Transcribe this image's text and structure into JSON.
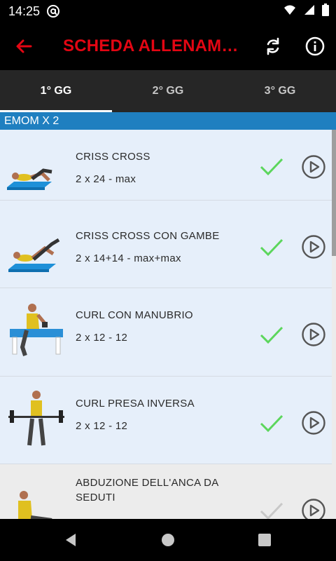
{
  "status": {
    "time": "14:25"
  },
  "header": {
    "title": "SCHEDA ALLENAME..."
  },
  "tabs": [
    {
      "label": "1° GG",
      "active": true
    },
    {
      "label": "2° GG",
      "active": false
    },
    {
      "label": "3° GG",
      "active": false
    }
  ],
  "section": {
    "label": "EMOM X 2"
  },
  "exercises": [
    {
      "title": "CRISS CROSS",
      "sets": "2 x 24 - max",
      "done": true
    },
    {
      "title": "CRISS CROSS CON GAMBE",
      "sets": "2 x 14+14 - max+max",
      "done": true
    },
    {
      "title": "CURL CON MANUBRIO",
      "sets": "2 x 12 - 12",
      "done": true
    },
    {
      "title": "CURL PRESA INVERSA",
      "sets": "2 x 12 - 12",
      "done": true
    },
    {
      "title": "ABDUZIONE DELL'ANCA DA SEDUTI",
      "sets": "",
      "done": false
    }
  ],
  "colors": {
    "accent": "#e30613",
    "section": "#1f7fc0",
    "check": "#5cd65c",
    "row_bg": "#e6effa"
  }
}
